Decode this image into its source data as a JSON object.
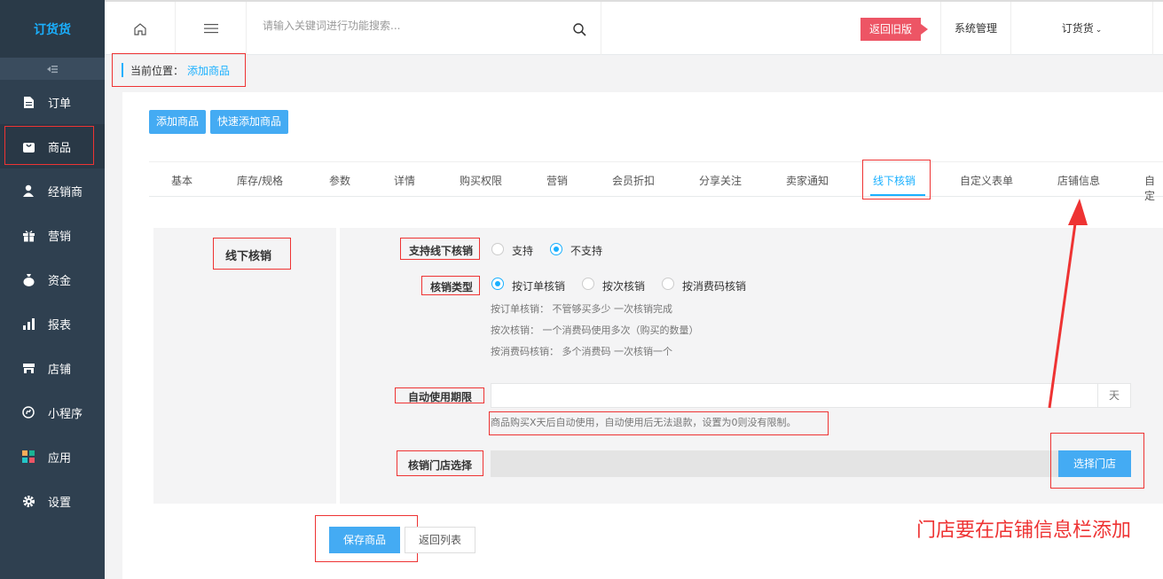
{
  "app": {
    "logo": "订货货"
  },
  "sidebar": {
    "items": [
      {
        "label": "订单",
        "icon": "file-icon"
      },
      {
        "label": "商品",
        "icon": "bag-icon"
      },
      {
        "label": "经销商",
        "icon": "user-icon"
      },
      {
        "label": "营销",
        "icon": "gift-icon"
      },
      {
        "label": "资金",
        "icon": "money-bag-icon"
      },
      {
        "label": "报表",
        "icon": "bar-chart-icon"
      },
      {
        "label": "店铺",
        "icon": "store-icon"
      },
      {
        "label": "小程序",
        "icon": "mini-program-icon"
      },
      {
        "label": "应用",
        "icon": "apps-icon"
      },
      {
        "label": "设置",
        "icon": "gear-icon"
      }
    ]
  },
  "header": {
    "search_placeholder": "请输入关键词进行功能搜索...",
    "old_version": "返回旧版",
    "system": "系统管理",
    "user": "订货货"
  },
  "breadcrumb": {
    "prefix": "当前位置：",
    "current": "添加商品"
  },
  "buttons": {
    "add_product": "添加商品",
    "quick_add": "快速添加商品",
    "save": "保存商品",
    "back": "返回列表",
    "select_store": "选择门店"
  },
  "tabs": [
    "基本",
    "库存/规格",
    "参数",
    "详情",
    "购买权限",
    "营销",
    "会员折扣",
    "分享关注",
    "卖家通知",
    "线下核销",
    "自定义表单",
    "店铺信息",
    "自定"
  ],
  "section": {
    "title": "线下核销"
  },
  "form": {
    "support_label": "支持线下核销",
    "support_yes": "支持",
    "support_no": "不支持",
    "type_label": "核销类型",
    "type_order": "按订单核销",
    "type_times": "按次核销",
    "type_code": "按消费码核销",
    "hint1": "按订单核销： 不管够买多少 一次核销完成",
    "hint2": "按次核销： 一个消费码使用多次（购买的数量）",
    "hint3": "按消费码核销： 多个消费码 一次核销一个",
    "auto_label": "自动使用期限",
    "auto_unit": "天",
    "auto_hint": "商品购买X天后自动使用，自动使用后无法退款，设置为0则没有限制。",
    "store_label": "核销门店选择"
  },
  "annotation": "门店要在店铺信息栏添加"
}
